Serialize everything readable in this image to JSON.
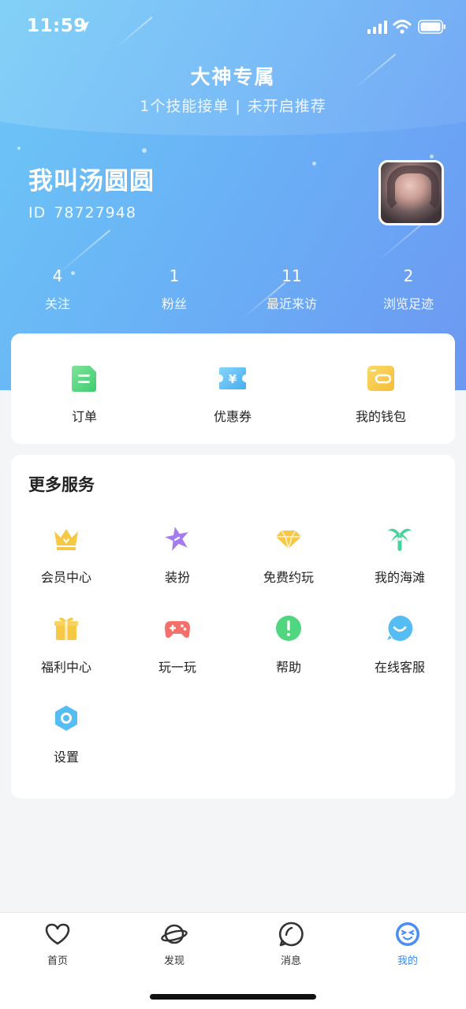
{
  "status_bar": {
    "time": "11:59",
    "icons": [
      "location-arrow-icon",
      "signal-icon",
      "wifi-icon",
      "battery-icon"
    ]
  },
  "banner": {
    "title": "大神专属",
    "subtitle_left": "1个技能接单",
    "separator": "|",
    "subtitle_right": "未开启推荐"
  },
  "profile": {
    "name": "我叫汤圆圆",
    "id_label": "ID",
    "id_value": "78727948"
  },
  "stats": [
    {
      "value": "4",
      "label": "关注"
    },
    {
      "value": "1",
      "label": "粉丝"
    },
    {
      "value": "11",
      "label": "最近来访"
    },
    {
      "value": "2",
      "label": "浏览足迹"
    }
  ],
  "quick_actions": [
    {
      "label": "订单",
      "icon": "order-icon",
      "color": "#4fd67e"
    },
    {
      "label": "优惠券",
      "icon": "coupon-icon",
      "color": "#5cc0f4"
    },
    {
      "label": "我的钱包",
      "icon": "wallet-icon",
      "color": "#f6cb4a"
    }
  ],
  "more_services": {
    "title": "更多服务",
    "items": [
      {
        "label": "会员中心",
        "icon": "crown-icon",
        "color": "#f7c946"
      },
      {
        "label": "装扮",
        "icon": "star-icon",
        "color": "#a67cf0"
      },
      {
        "label": "免费约玩",
        "icon": "diamond-icon",
        "color": "#f7c946"
      },
      {
        "label": "我的海滩",
        "icon": "palm-tree-icon",
        "color": "#47d39a"
      },
      {
        "label": "福利中心",
        "icon": "gift-icon",
        "color": "#f7c946"
      },
      {
        "label": "玩一玩",
        "icon": "gamepad-icon",
        "color": "#f4736a"
      },
      {
        "label": "帮助",
        "icon": "help-icon",
        "color": "#4fd67e"
      },
      {
        "label": "在线客服",
        "icon": "smile-icon",
        "color": "#5cc0f4"
      },
      {
        "label": "设置",
        "icon": "settings-icon",
        "color": "#5cc0f4"
      }
    ]
  },
  "tab_bar": {
    "active": "我的",
    "tabs": [
      {
        "label": "首页",
        "icon": "heart-icon"
      },
      {
        "label": "发现",
        "icon": "planet-icon"
      },
      {
        "label": "消息",
        "icon": "message-icon"
      },
      {
        "label": "我的",
        "icon": "face-icon"
      }
    ]
  }
}
